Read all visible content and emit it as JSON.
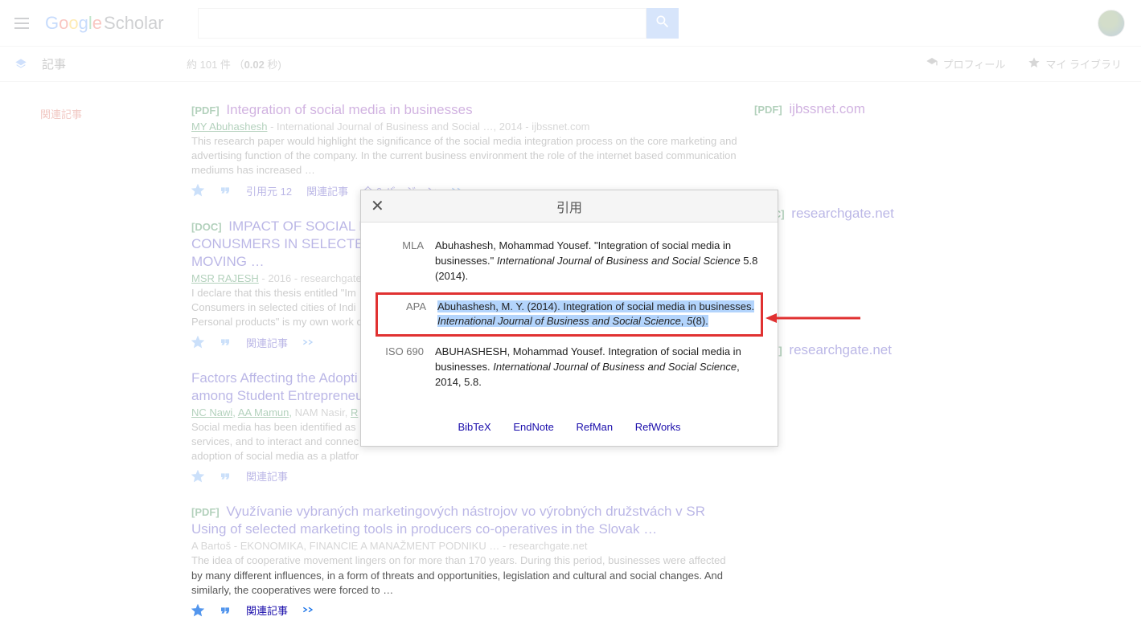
{
  "header": {
    "logo_google": {
      "g1": "G",
      "o1": "o",
      "o2": "o",
      "g2": "g",
      "l": "l",
      "e": "e"
    },
    "logo_scholar": "Scholar",
    "search_value": ""
  },
  "subbar": {
    "articles": "記事",
    "count_prefix": "約 101 件",
    "time": "0.02",
    "time_suffix": " 秒)",
    "profile": "プロフィール",
    "library": "マイ ライブラリ"
  },
  "sidebar": {
    "related": "関連記事"
  },
  "results": [
    {
      "tag": "[PDF]",
      "title": "Integration of social media in businesses",
      "link_class": "purple",
      "authors": "MY Abuhashesh",
      "meta": " - International Journal of Business and Social …, 2014 - ijbssnet.com",
      "snippet": "This research paper would highlight the significance of the social media integration process on the core marketing and advertising function of the company. In the current business environment the role of the internet based communication mediums has increased …",
      "cited": "引用元 12",
      "related": "関連記事",
      "versions": "全 6 バージョン",
      "pdf_tag": "[PDF]",
      "pdf_host": "ijbssnet.com",
      "pdf_class": "purple"
    },
    {
      "tag": "[DOC]",
      "title": "IMPACT OF SOCIAL M… CONUSMERS IN SELECTE… MOVING …",
      "link_class": "blue",
      "authors": "MSR RAJESH",
      "meta": " - 2016 - researchgate…",
      "snippet": "I declare that this thesis entitled \"Im… Consumers in selected cities of Indi… Personal products\" is my own work …",
      "related": "関連記事",
      "pdf_tag": "[DOC]",
      "pdf_host": "researchgate.net",
      "pdf_class": "blue"
    },
    {
      "tag": "",
      "title": "Factors Affecting the Adopti… among Student Entrepreneu…",
      "link_class": "blue",
      "authors_html": "NC Nawi, AA Mamun, NAM Nasir, R…",
      "meta": "",
      "snippet": "Social media has been identified as … services, and to interact and connec… adoption of social media as a platfor…",
      "related": "関連記事",
      "pdf_tag": "[PDF]",
      "pdf_host": "researchgate.net",
      "pdf_class": "blue"
    },
    {
      "tag": "[PDF]",
      "title": "Využívanie vybraných marketingových nástrojov vo výrobných družstvách v SR Using of selected marketing tools in producers co-operatives in the Slovak …",
      "link_class": "blue",
      "authors": "A Bartoš",
      "meta": " - EKONOMIKA, FINANCIE A MANAŽMENT PODNIKU … - researchgate.net",
      "snippet": "The idea of cooperative movement lingers on for more than 170 years. During this period, businesses were affected by many different influences, in a form of threats and opportunities, legislation and cultural and social changes. And similarly, the cooperatives were forced to …",
      "related": "関連記事",
      "pdf_tag": "[PDF]",
      "pdf_host": "researchgate.net",
      "pdf_class": "blue"
    }
  ],
  "dialog": {
    "title": "引用",
    "mla_label": "MLA",
    "mla_text_1": "Abuhashesh, Mohammad Yousef. \"Integration of social media in businesses.\" ",
    "mla_text_italic": "International Journal of Business and Social Science",
    "mla_text_2": " 5.8 (2014).",
    "apa_label": "APA",
    "apa_text_1": "Abuhashesh, M. Y. (2014). Integration of social media in businesses. ",
    "apa_text_italic": "International Journal of Business and Social Science",
    "apa_text_2": ", ",
    "apa_text_italic2": "5",
    "apa_text_3": "(8).",
    "iso_label": "ISO 690",
    "iso_text_1": "ABUHASHESH, Mohammad Yousef. Integration of social media in businesses. ",
    "iso_text_italic": "International Journal of Business and Social Science",
    "iso_text_2": ", 2014, 5.8.",
    "exports": [
      "BibTeX",
      "EndNote",
      "RefMan",
      "RefWorks"
    ]
  }
}
